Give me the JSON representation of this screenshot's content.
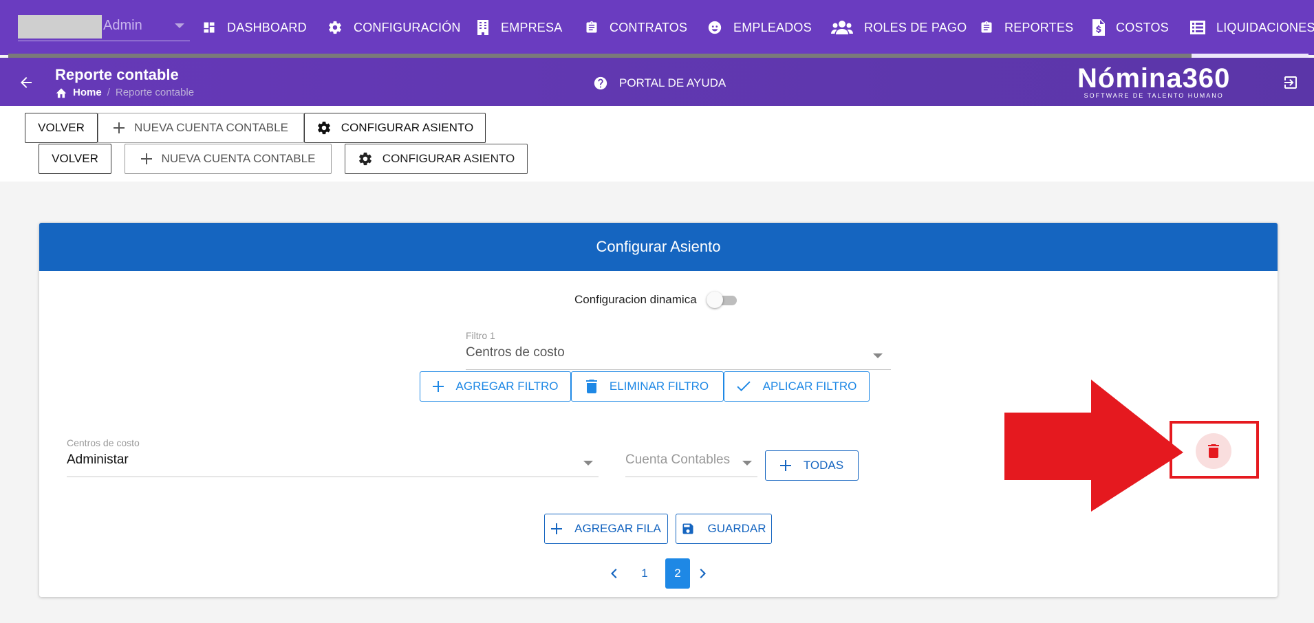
{
  "nav": {
    "user": "Admin",
    "progress_percent": 9,
    "items": [
      {
        "label": "DASHBOARD",
        "icon": "dashboard-icon"
      },
      {
        "label": "CONFIGURACIÓN",
        "icon": "gear-icon"
      },
      {
        "label": "EMPRESA",
        "icon": "building-icon"
      },
      {
        "label": "CONTRATOS",
        "icon": "clipboard-icon"
      },
      {
        "label": "EMPLEADOS",
        "icon": "face-icon"
      },
      {
        "label": "ROLES DE PAGO",
        "icon": "people-icon"
      },
      {
        "label": "REPORTES",
        "icon": "clipboard-icon"
      },
      {
        "label": "COSTOS",
        "icon": "dollar-file-icon"
      },
      {
        "label": "LIQUIDACIONES",
        "icon": "list-icon"
      }
    ]
  },
  "header": {
    "title": "Reporte contable",
    "breadcrumb_home": "Home",
    "breadcrumb_sep": "/",
    "breadcrumb_current": "Reporte contable",
    "help_label": "PORTAL DE AYUDA",
    "brand_name": "Nómina360",
    "brand_tagline": "SOFTWARE DE TALENTO HUMANO"
  },
  "toolbar": {
    "volver": "VOLVER",
    "nueva_cuenta": "NUEVA CUENTA CONTABLE",
    "configurar": "CONFIGURAR ASIENTO"
  },
  "card": {
    "title": "Configurar Asiento",
    "toggle_label": "Configuracion dinamica",
    "toggle_on": false,
    "filter_label": "Filtro 1",
    "filter_value": "Centros de costo",
    "btn_agregar_filtro": "AGREGAR FILTRO",
    "btn_eliminar_filtro": "ELIMINAR FILTRO",
    "btn_aplicar_filtro": "APLICAR FILTRO",
    "cc_label": "Centros de costo",
    "cc_value": "Administar",
    "cuenta_placeholder": "Cuenta Contables",
    "btn_todas": "TODAS",
    "btn_agregar_fila": "AGREGAR FILA",
    "btn_guardar": "GUARDAR",
    "pages": [
      "1",
      "2"
    ],
    "current_page": "2"
  },
  "colors": {
    "nav_bg": "#6a3cc0",
    "header_bg": "#5b36a8",
    "card_header": "#1565c0",
    "accent": "#1e88e5",
    "annotation_red": "#e5191f"
  }
}
